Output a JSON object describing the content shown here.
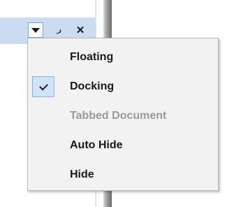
{
  "toolwindow": {
    "dropdown_icon": "chevron-down-icon",
    "pin_glyph": "᎕",
    "pin_icon": "pin-icon",
    "close_glyph": "✕",
    "close_icon": "close-icon"
  },
  "menu": {
    "items": [
      {
        "label": "Floating",
        "checked": false,
        "enabled": true
      },
      {
        "label": "Docking",
        "checked": true,
        "enabled": true
      },
      {
        "label": "Tabbed Document",
        "checked": false,
        "enabled": false
      },
      {
        "label": "Auto Hide",
        "checked": false,
        "enabled": true
      },
      {
        "label": "Hide",
        "checked": false,
        "enabled": true
      }
    ]
  },
  "colors": {
    "titlebar": "#c9dcf2",
    "menu_bg": "#f2f2f2",
    "check_bg": "#cfe3f8",
    "disabled_text": "#9a9a9a"
  }
}
